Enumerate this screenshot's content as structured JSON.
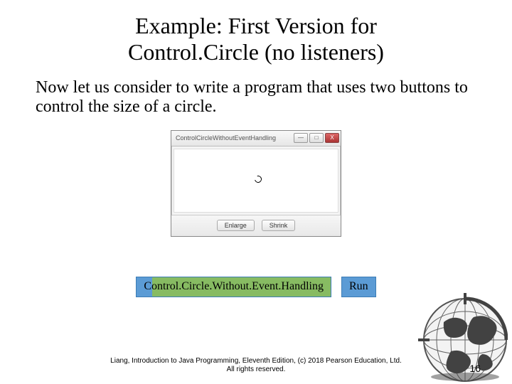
{
  "title_line1": "Example: First Version for",
  "title_line2": "Control.Circle (no listeners)",
  "body": "Now let us consider to write a program that uses two buttons to control the size of a circle.",
  "mock": {
    "window_title": "ControlCircleWithoutEventHandling",
    "enlarge": "Enlarge",
    "shrink": "Shrink",
    "min": "—",
    "max": "□",
    "close": "X"
  },
  "links": {
    "code": "Control.Circle.Without.Event.Handling",
    "run": "Run"
  },
  "footer_line1": "Liang, Introduction to Java Programming, Eleventh Edition, (c) 2018 Pearson Education, Ltd.",
  "footer_line2": "All rights reserved.",
  "page": "16"
}
